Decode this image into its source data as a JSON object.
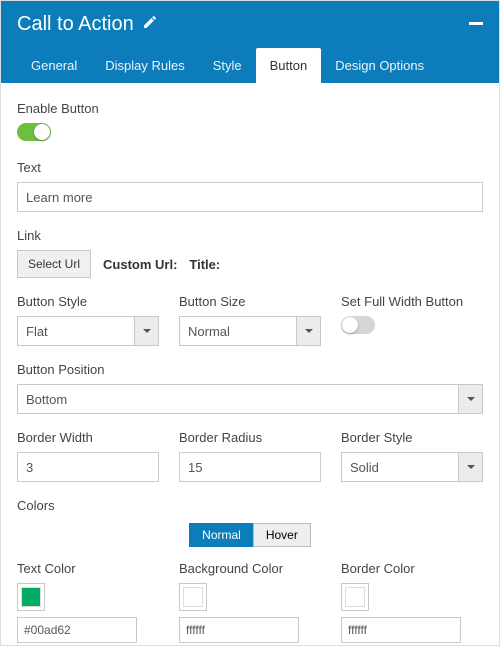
{
  "header": {
    "title": "Call to Action",
    "tabs": [
      "General",
      "Display Rules",
      "Style",
      "Button",
      "Design Options"
    ],
    "activeTab": 3
  },
  "enableButton": {
    "label": "Enable Button",
    "value": true
  },
  "text": {
    "label": "Text",
    "value": "Learn more"
  },
  "link": {
    "label": "Link",
    "selectBtn": "Select Url",
    "customUrlLabel": "Custom Url:",
    "titleLabel": "Title:"
  },
  "buttonStyle": {
    "label": "Button Style",
    "value": "Flat"
  },
  "buttonSize": {
    "label": "Button Size",
    "value": "Normal"
  },
  "fullWidth": {
    "label": "Set Full Width Button",
    "value": false
  },
  "buttonPosition": {
    "label": "Button Position",
    "value": "Bottom"
  },
  "borderWidth": {
    "label": "Border Width",
    "value": "3"
  },
  "borderRadius": {
    "label": "Border Radius",
    "value": "15"
  },
  "borderStyle": {
    "label": "Border Style",
    "value": "Solid"
  },
  "colors": {
    "sectionLabel": "Colors",
    "stateTabs": [
      "Normal",
      "Hover"
    ],
    "activeState": 0,
    "textColor": {
      "label": "Text Color",
      "hex": "#00ad62",
      "swatch": "#00ad62"
    },
    "backgroundColor": {
      "label": "Background Color",
      "hex": "ffffff",
      "swatch": "#ffffff"
    },
    "borderColor": {
      "label": "Border Color",
      "hex": "ffffff",
      "swatch": "#ffffff"
    }
  }
}
